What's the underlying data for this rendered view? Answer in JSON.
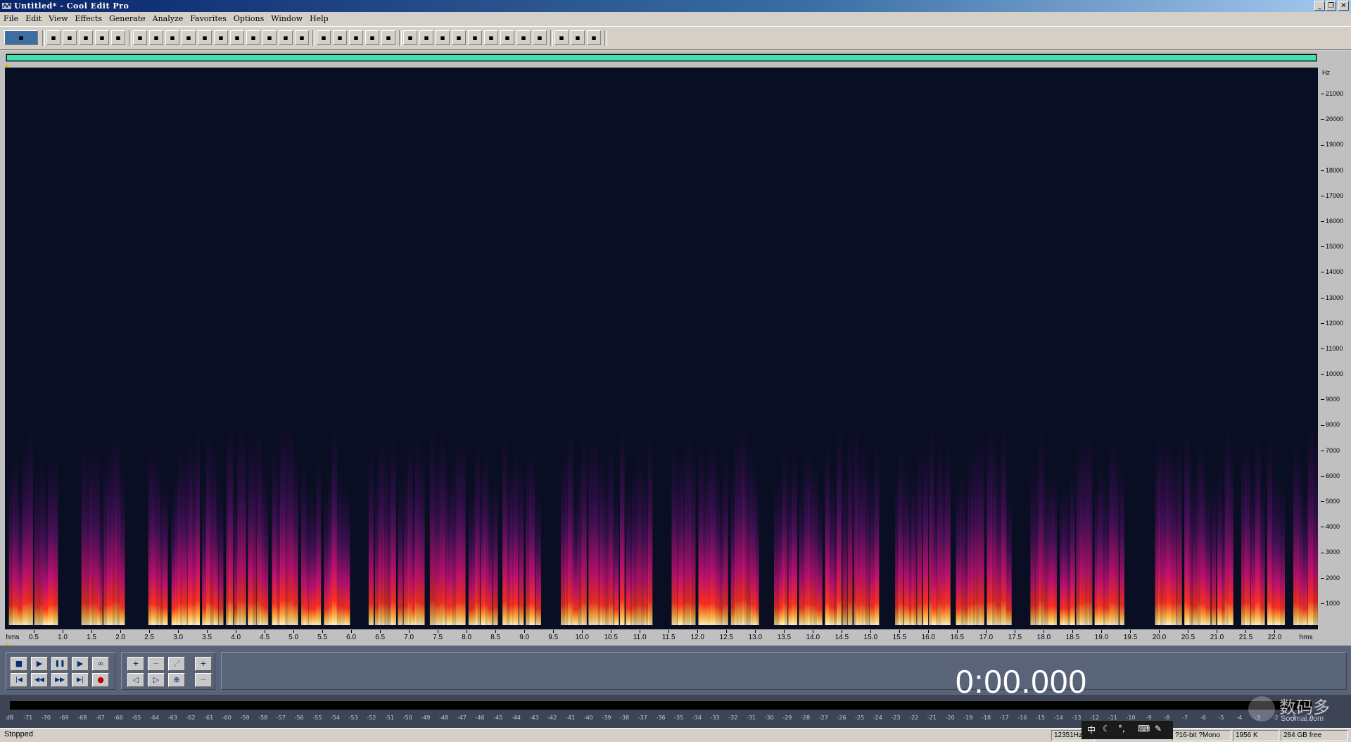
{
  "window": {
    "title": "Untitled* - Cool Edit Pro",
    "minimize": "_",
    "restore": "❐",
    "close": "✕"
  },
  "menu": [
    "File",
    "Edit",
    "View",
    "Effects",
    "Generate",
    "Analyze",
    "Favorites",
    "Options",
    "Window",
    "Help"
  ],
  "toolbar": {
    "groups": [
      [
        "waveform-view-icon"
      ],
      [
        "new-file-icon",
        "open-file-icon",
        "save-icon",
        "save-all-icon",
        "close-file-icon"
      ],
      [
        "undo-icon",
        "redo-icon",
        "repeat-icon",
        "copy-icon",
        "copy-new-icon",
        "cut-icon",
        "trim-icon",
        "mix-paste-icon",
        "paste-icon",
        "paste-new-icon",
        "record-icon"
      ],
      [
        "spectral-view-icon",
        "envelope-icon",
        "fx-1-icon",
        "fx-2-icon",
        "fx-3-icon"
      ],
      [
        "frequency-analysis-icon",
        "statistics-icon",
        "scan-icon",
        "play-pointer-icon",
        "zoom-tool-icon",
        "time-format-icon",
        "number-format-icon",
        "cue-list-icon",
        "play-list-icon"
      ],
      [
        "settings-icon",
        "scripts-icon",
        "help-icon"
      ]
    ]
  },
  "spectral": {
    "freq_unit": "Hz",
    "freq_ticks": [
      "21000",
      "20000",
      "19000",
      "18000",
      "17000",
      "16000",
      "15000",
      "14000",
      "13000",
      "12000",
      "11000",
      "10000",
      "9000",
      "8000",
      "7000",
      "6000",
      "5000",
      "4000",
      "3000",
      "2000",
      "1000"
    ],
    "time_unit_left": "hms",
    "time_unit_right": "hms",
    "time_ticks": [
      "0.5",
      "1.0",
      "1.5",
      "2.0",
      "2.5",
      "3.0",
      "3.5",
      "4.0",
      "4.5",
      "5.0",
      "5.5",
      "6.0",
      "6.5",
      "7.0",
      "7.5",
      "8.0",
      "8.5",
      "9.0",
      "9.5",
      "10.0",
      "10.5",
      "11.0",
      "11.5",
      "12.0",
      "12.5",
      "13.0",
      "13.5",
      "14.0",
      "14.5",
      "15.0",
      "15.5",
      "16.0",
      "16.5",
      "17.0",
      "17.5",
      "18.0",
      "18.5",
      "19.0",
      "19.5",
      "20.0",
      "20.5",
      "21.0",
      "21.5",
      "22.0"
    ],
    "time_end_seconds": 22.75,
    "freq_max_hz": 22050,
    "speech_segments": [
      [
        0.05,
        0.45
      ],
      [
        0.5,
        0.9
      ],
      [
        1.3,
        2.05
      ],
      [
        2.45,
        2.8
      ],
      [
        2.85,
        3.35
      ],
      [
        3.4,
        3.75
      ],
      [
        3.8,
        4.15
      ],
      [
        4.2,
        4.55
      ],
      [
        4.6,
        5.05
      ],
      [
        5.1,
        5.45
      ],
      [
        5.5,
        5.95
      ],
      [
        6.3,
        6.75
      ],
      [
        6.8,
        7.25
      ],
      [
        7.35,
        7.95
      ],
      [
        8.0,
        8.5
      ],
      [
        8.6,
        8.95
      ],
      [
        9.0,
        9.25
      ],
      [
        9.6,
        10.05
      ],
      [
        10.1,
        10.6
      ],
      [
        10.65,
        11.2
      ],
      [
        11.55,
        11.95
      ],
      [
        12.0,
        12.5
      ],
      [
        12.55,
        13.05
      ],
      [
        13.3,
        13.7
      ],
      [
        13.75,
        14.15
      ],
      [
        14.2,
        14.55
      ],
      [
        14.6,
        15.1
      ],
      [
        15.4,
        15.85
      ],
      [
        15.9,
        16.35
      ],
      [
        16.45,
        16.95
      ],
      [
        17.0,
        17.4
      ],
      [
        17.75,
        18.2
      ],
      [
        18.25,
        18.8
      ],
      [
        18.85,
        19.35
      ],
      [
        19.9,
        20.35
      ],
      [
        20.4,
        20.85
      ],
      [
        20.9,
        21.25
      ],
      [
        21.4,
        21.8
      ],
      [
        21.85,
        22.15
      ],
      [
        22.3,
        22.7
      ]
    ]
  },
  "transport": {
    "stop": "■",
    "play": "▶",
    "pause": "❚❚",
    "play_to_end": "▶",
    "loop": "∞",
    "go_start": "|◀",
    "rewind": "◀◀",
    "fast_forward": "▶▶",
    "go_end": "▶|",
    "record": "●",
    "zoom_in_h": "+",
    "zoom_out_h": "−",
    "zoom_full": "⤢",
    "zoom_in_v": "+",
    "zoom_left": "◁",
    "zoom_right": "▷",
    "zoom_selection": "⊕",
    "zoom_out_v": "−"
  },
  "time_display": "0:00.000",
  "meter": {
    "labels": [
      "dB",
      "-71",
      "-70",
      "-69",
      "-68",
      "-67",
      "-66",
      "-65",
      "-64",
      "-63",
      "-62",
      "-61",
      "-60",
      "-59",
      "-58",
      "-57",
      "-56",
      "-55",
      "-54",
      "-53",
      "-52",
      "-51",
      "-50",
      "-49",
      "-48",
      "-47",
      "-46",
      "-45",
      "-44",
      "-43",
      "-42",
      "-41",
      "-40",
      "-39",
      "-38",
      "-37",
      "-36",
      "-35",
      "-34",
      "-33",
      "-32",
      "-31",
      "-30",
      "-29",
      "-28",
      "-27",
      "-26",
      "-25",
      "-24",
      "-23",
      "-22",
      "-21",
      "-20",
      "-19",
      "-18",
      "-17",
      "-16",
      "-15",
      "-14",
      "-13",
      "-12",
      "-11",
      "-10",
      "-9",
      "-8",
      "-7",
      "-6",
      "-5",
      "-4",
      "-3",
      "-2",
      "-1",
      "0"
    ]
  },
  "status": {
    "state": "Stopped",
    "sample_info": "12351Hz",
    "format": "?16-bit ?Mono",
    "size": "1956 K",
    "free": "284 GB free",
    "tray_ime": "中"
  },
  "watermark": {
    "main": "数码多",
    "sub": "Soomal.com"
  }
}
